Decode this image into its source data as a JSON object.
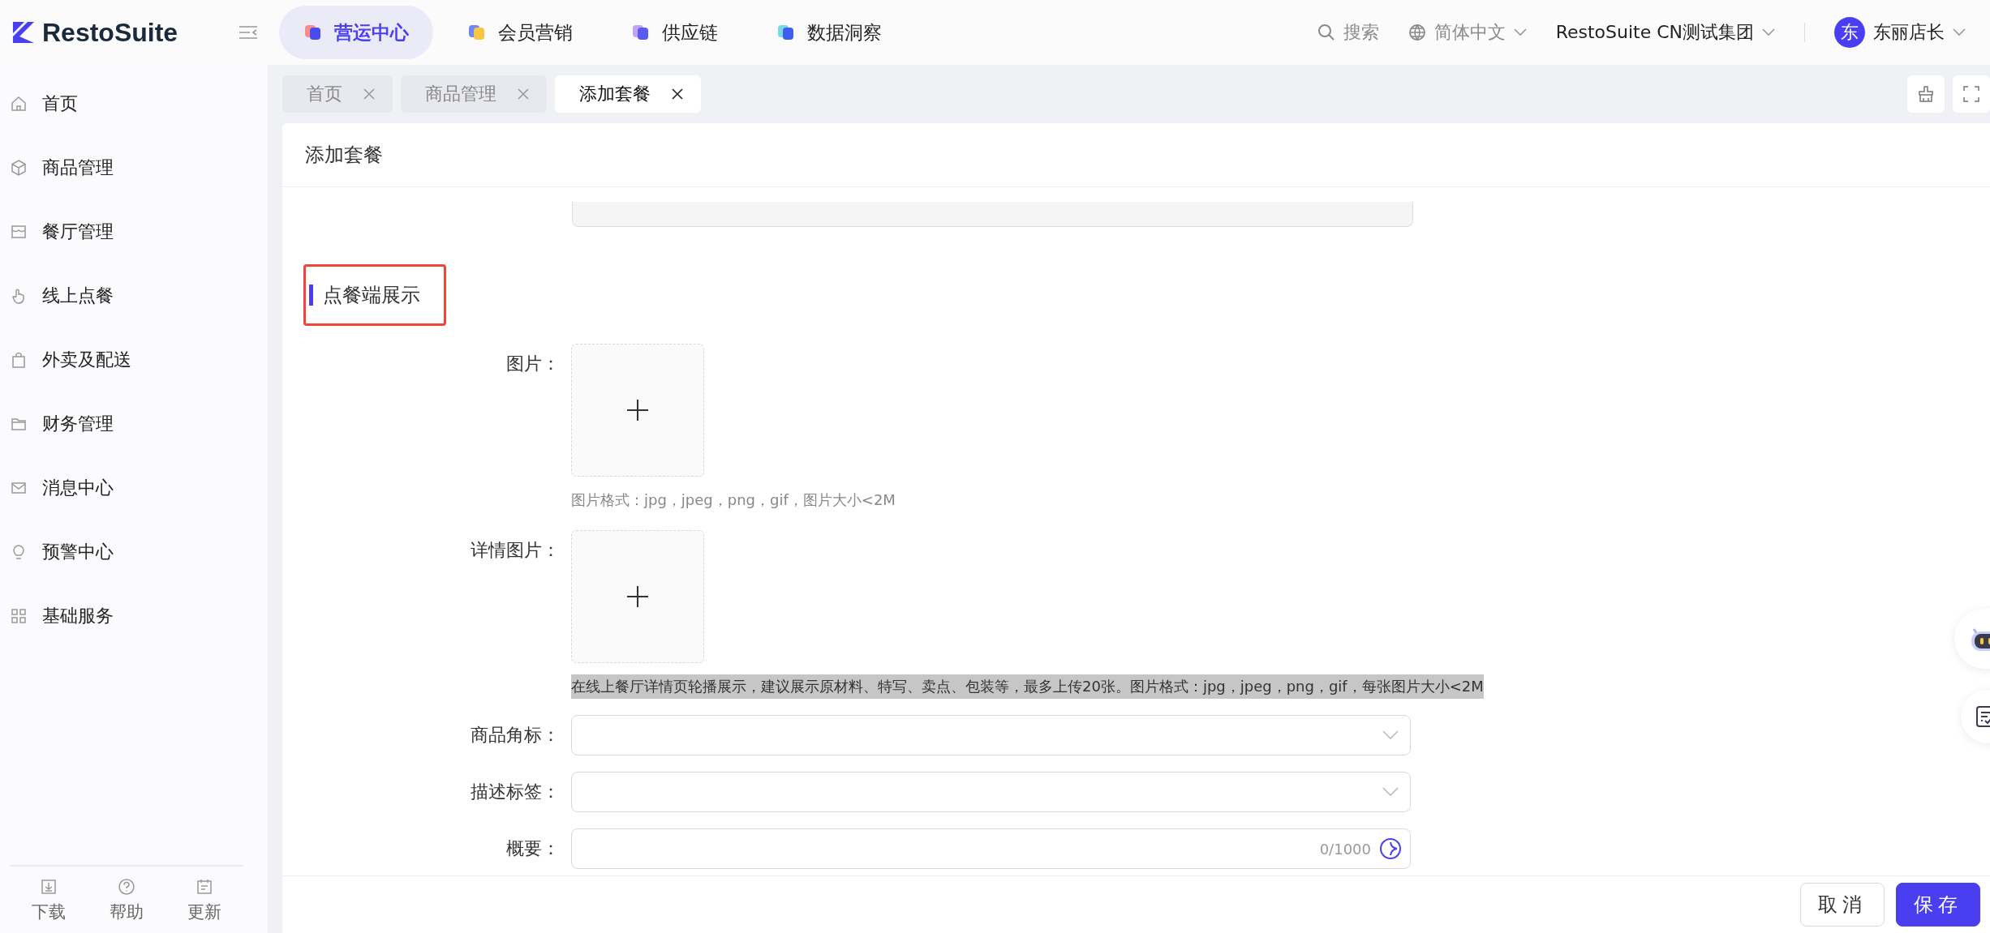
{
  "brand": {
    "name": "RestoSuite"
  },
  "top_nav": [
    {
      "label": "营运中心",
      "selected": true,
      "kind": "ops"
    },
    {
      "label": "会员营销",
      "selected": false,
      "kind": "member"
    },
    {
      "label": "供应链",
      "selected": false,
      "kind": "supply"
    },
    {
      "label": "数据洞察",
      "selected": false,
      "kind": "data"
    }
  ],
  "header_right": {
    "search": "搜索",
    "language": "简体中文",
    "org": "RestoSuite CN测试集团",
    "avatar": "东",
    "user": "东丽店长"
  },
  "sidebar": {
    "items": [
      {
        "label": "首页"
      },
      {
        "label": "商品管理"
      },
      {
        "label": "餐厅管理"
      },
      {
        "label": "线上点餐"
      },
      {
        "label": "外卖及配送"
      },
      {
        "label": "财务管理"
      },
      {
        "label": "消息中心"
      },
      {
        "label": "预警中心"
      },
      {
        "label": "基础服务"
      }
    ],
    "footer": [
      {
        "label": "下载"
      },
      {
        "label": "帮助"
      },
      {
        "label": "更新"
      }
    ]
  },
  "tabs": [
    {
      "label": "首页",
      "selected": false
    },
    {
      "label": "商品管理",
      "selected": false
    },
    {
      "label": "添加套餐",
      "selected": true
    }
  ],
  "page": {
    "title": "添加套餐",
    "section": "点餐端展示",
    "fields": [
      {
        "kind": "upload",
        "label": "图片：",
        "hint": "图片格式：jpg，jpeg，png，gif，图片大小<2M",
        "hint_selected": false
      },
      {
        "kind": "upload",
        "label": "详情图片：",
        "hint": "在线上餐厅详情页轮播展示，建议展示原材料、特写、卖点、包装等，最多上传20张。图片格式：jpg，jpeg，png，gif，每张图片大小<2M",
        "hint_selected": true
      },
      {
        "kind": "select",
        "label": "商品角标："
      },
      {
        "kind": "select",
        "label": "描述标签："
      },
      {
        "kind": "text",
        "label": "概要：",
        "counter": "0/1000"
      }
    ]
  },
  "footer_buttons": [
    {
      "label": "取消",
      "primary": false
    },
    {
      "label": "保存",
      "primary": true
    }
  ]
}
